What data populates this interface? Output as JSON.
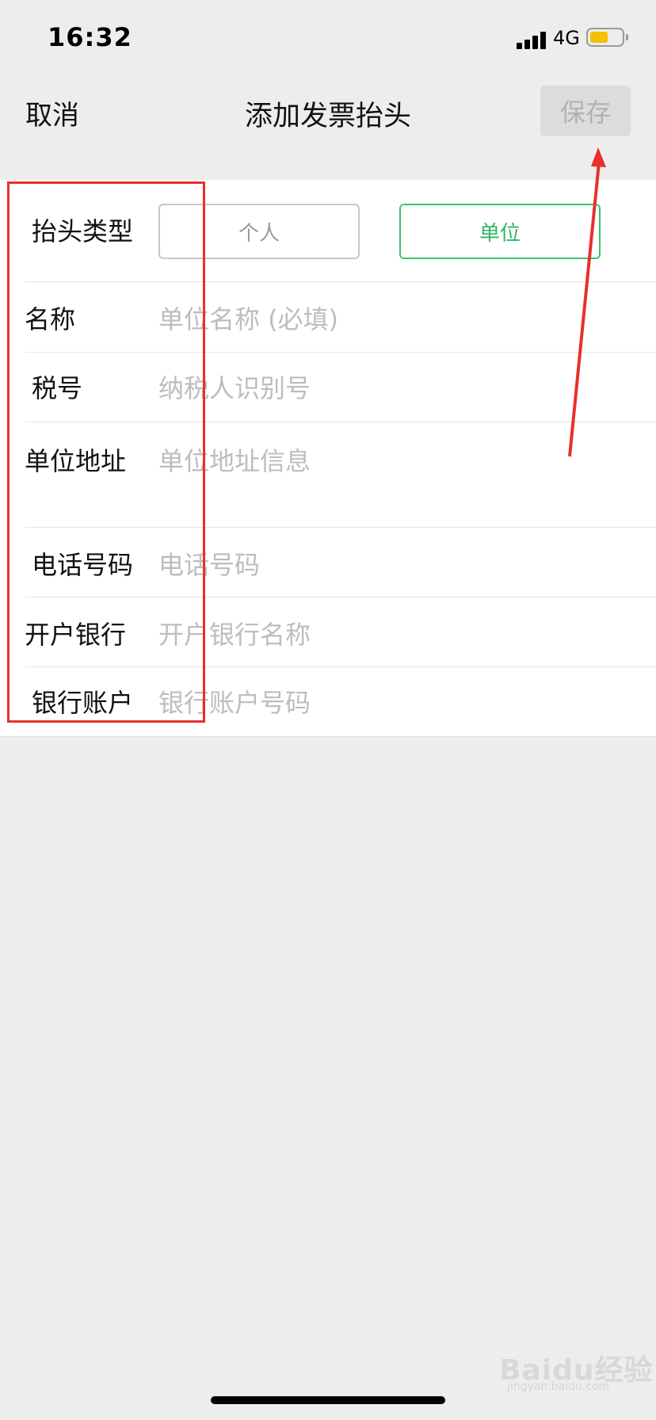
{
  "status_bar": {
    "time": "16:32",
    "network": "4G",
    "battery_color": "#f5c000"
  },
  "nav": {
    "cancel_label": "取消",
    "title": "添加发票抬头",
    "save_label": "保存"
  },
  "form": {
    "type_row": {
      "label": "抬头类型",
      "options": [
        "个人",
        "单位"
      ],
      "selected": "单位"
    },
    "fields": [
      {
        "label": "名称",
        "placeholder": "单位名称 (必填)"
      },
      {
        "label": "税号",
        "placeholder": "纳税人识别号"
      },
      {
        "label": "单位地址",
        "placeholder": "单位地址信息"
      },
      {
        "label": "电话号码",
        "placeholder": "电话号码"
      },
      {
        "label": "开户银行",
        "placeholder": "开户银行名称"
      },
      {
        "label": "银行账户",
        "placeholder": "银行账户号码"
      }
    ]
  },
  "colors": {
    "accent_green": "#3cc46c",
    "annotation_red": "#e8302c"
  },
  "watermark": {
    "text": "Baidu经验",
    "sub": "jingyan.baidu.com"
  }
}
